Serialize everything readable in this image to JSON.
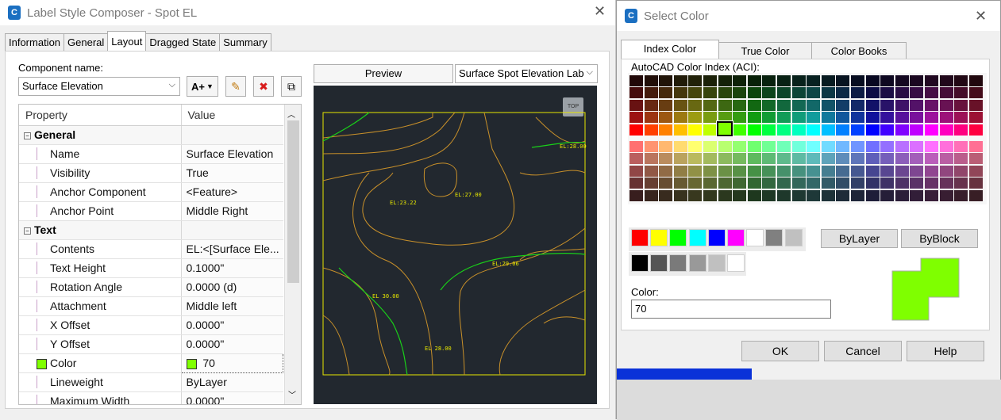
{
  "composer": {
    "title": "Label Style Composer - Spot EL",
    "tabs": [
      "Information",
      "General",
      "Layout",
      "Dragged State",
      "Summary"
    ],
    "component_name_label": "Component name:",
    "component_name_value": "Surface Elevation",
    "add_button_glyph": "A+",
    "preview_button": "Preview",
    "preview_style": "Surface Spot Elevation Lab",
    "preview_top_badge": "TOP",
    "grid_headers": {
      "property": "Property",
      "value": "Value"
    },
    "categories": {
      "general": "General",
      "text": "Text"
    },
    "general_rows": [
      {
        "p": "Name",
        "v": "Surface Elevation"
      },
      {
        "p": "Visibility",
        "v": "True"
      },
      {
        "p": "Anchor Component",
        "v": "<Feature>"
      },
      {
        "p": "Anchor Point",
        "v": "Middle Right"
      }
    ],
    "text_rows": [
      {
        "p": "Contents",
        "v": "EL:<[Surface Ele..."
      },
      {
        "p": "Text Height",
        "v": "0.1000\""
      },
      {
        "p": "Rotation Angle",
        "v": "0.0000 (d)"
      },
      {
        "p": "Attachment",
        "v": "Middle left"
      },
      {
        "p": "X Offset",
        "v": "0.0000\""
      },
      {
        "p": "Y Offset",
        "v": "0.0000\""
      }
    ],
    "color_row": {
      "p": "Color",
      "v": "70"
    },
    "after_rows": [
      {
        "p": "Lineweight",
        "v": "ByLayer"
      },
      {
        "p": "Maximum Width",
        "v": "0.0000\""
      }
    ],
    "preview_labels": [
      "EL:28.00",
      "EL:23.22",
      "EL:27.00",
      "EL:29.06",
      "EL 30.00",
      "EL 28.00"
    ]
  },
  "select_color": {
    "title": "Select Color",
    "tabs": [
      "Index Color",
      "True Color",
      "Color Books"
    ],
    "aci_label": "AutoCAD Color Index (ACI):",
    "bylayer": "ByLayer",
    "byblock": "ByBlock",
    "color_label": "Color:",
    "color_value": "70",
    "ok": "OK",
    "cancel": "Cancel",
    "help": "Help",
    "selected_hex": "#7fff00",
    "standard_colors": [
      "#ff0000",
      "#ffff00",
      "#00ff00",
      "#00ffff",
      "#0000ff",
      "#ff00ff",
      "#ffffff",
      "#808080",
      "#c0c0c0"
    ],
    "gray_colors": [
      "#000000",
      "#555555",
      "#7a7a7a",
      "#999999",
      "#c0c0c0",
      "#ffffff"
    ]
  }
}
